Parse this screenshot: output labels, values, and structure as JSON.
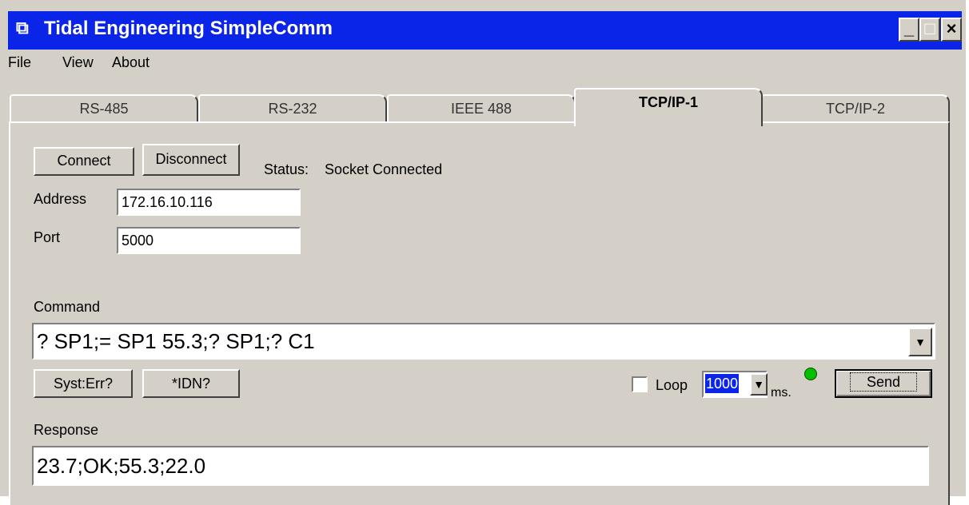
{
  "window": {
    "title": "Tidal Engineering SimpleComm",
    "controls": [
      "_",
      "□",
      "×"
    ]
  },
  "menu": {
    "items": [
      "File",
      "View",
      "About"
    ]
  },
  "tabs": [
    "RS-485",
    "RS-232",
    "IEEE 488",
    "TCP/IP-1",
    "TCP/IP-2"
  ],
  "active_tab": "TCP/IP-1",
  "connection": {
    "connect_label": "Connect",
    "disconnect_label": "Disconnect",
    "status_label": "Status:",
    "status_value": "Socket Connected",
    "address_label": "Address",
    "address_value": "172.16.10.116",
    "port_label": "Port",
    "port_value": "5000"
  },
  "command": {
    "label": "Command",
    "value": "? SP1;= SP1 55.3;? SP1;? C1",
    "syst_err_label": "Syst:Err?",
    "idn_label": "*IDN?",
    "loop_label": "Loop",
    "loop_checked": false,
    "interval_value": "1000",
    "interval_unit": "ms.",
    "send_label": "Send",
    "indicator_color": "#00c000"
  },
  "response": {
    "label": "Response",
    "value": "23.7;OK;55.3;22.0"
  }
}
